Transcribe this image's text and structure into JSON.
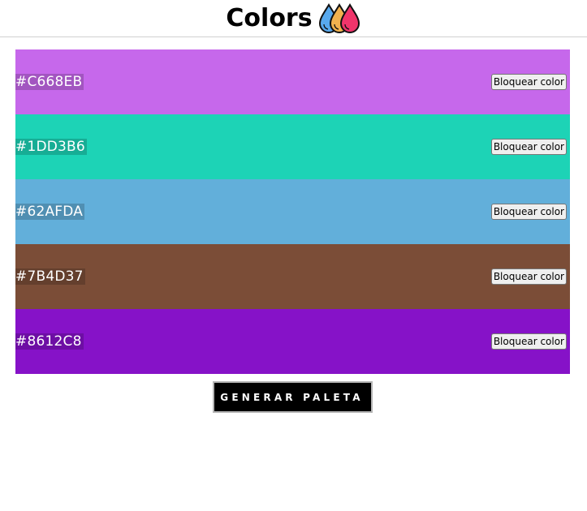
{
  "header": {
    "title": "Colors",
    "drop_colors": [
      "#58a9ee",
      "#f2b24e",
      "#f0356b"
    ]
  },
  "palette": {
    "lock_label": "Bloquear color",
    "swatches": [
      {
        "hex": "#C668EB",
        "color": "#C668EB"
      },
      {
        "hex": "#1DD3B6",
        "color": "#1DD3B6"
      },
      {
        "hex": "#62AFDA",
        "color": "#62AFDA"
      },
      {
        "hex": "#7B4D37",
        "color": "#7B4D37"
      },
      {
        "hex": "#8612C8",
        "color": "#8612C8"
      }
    ]
  },
  "actions": {
    "generate_label": "GENERAR PALETA"
  }
}
